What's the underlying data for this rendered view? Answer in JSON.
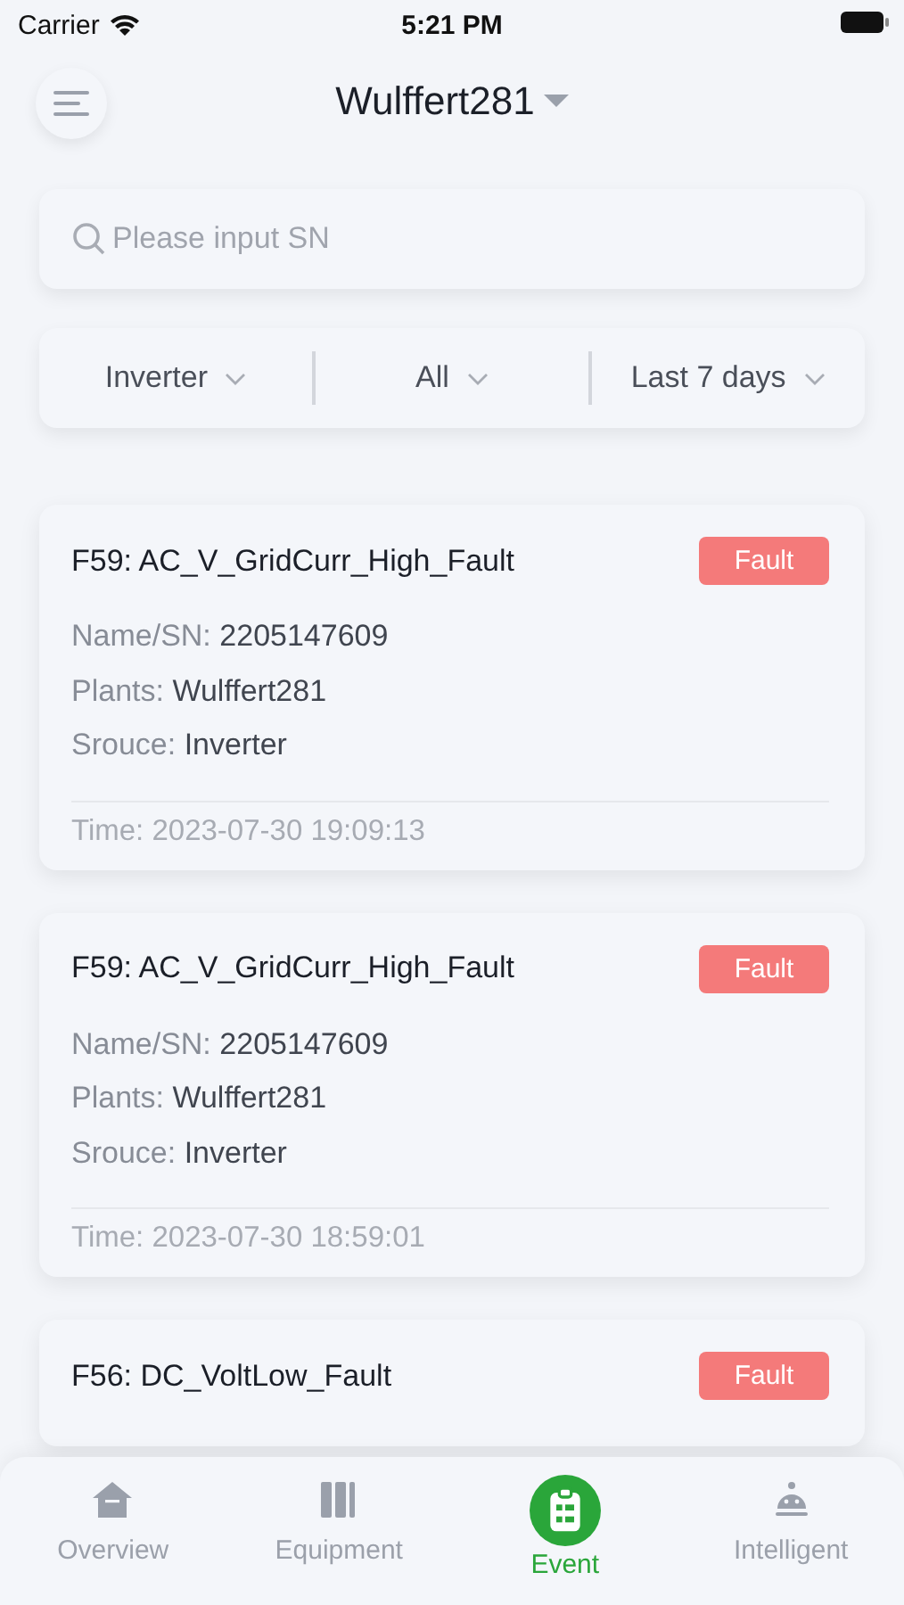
{
  "status_bar": {
    "carrier": "Carrier",
    "time": "5:21 PM"
  },
  "header": {
    "title": "Wulffert281"
  },
  "search": {
    "placeholder": "Please input SN"
  },
  "filters": [
    {
      "label": "Inverter"
    },
    {
      "label": "All"
    },
    {
      "label": "Last 7 days"
    }
  ],
  "events": [
    {
      "title": "F59: AC_V_GridCurr_High_Fault",
      "badge": "Fault",
      "fields": [
        {
          "label": "Name/SN:",
          "value": "2205147609"
        },
        {
          "label": "Plants:",
          "value": "Wulffert281"
        },
        {
          "label": "Srouce:",
          "value": "Inverter"
        }
      ],
      "time": "Time: 2023-07-30 19:09:13"
    },
    {
      "title": "F59: AC_V_GridCurr_High_Fault",
      "badge": "Fault",
      "fields": [
        {
          "label": "Name/SN:",
          "value": "2205147609"
        },
        {
          "label": "Plants:",
          "value": "Wulffert281"
        },
        {
          "label": "Srouce:",
          "value": "Inverter"
        }
      ],
      "time": "Time: 2023-07-30 18:59:01"
    },
    {
      "title": "F56: DC_VoltLow_Fault",
      "badge": "Fault"
    }
  ],
  "tabs": [
    {
      "label": "Overview",
      "selected": false
    },
    {
      "label": "Equipment",
      "selected": false
    },
    {
      "label": "Event",
      "selected": true
    },
    {
      "label": "Intelligent",
      "selected": false
    }
  ]
}
